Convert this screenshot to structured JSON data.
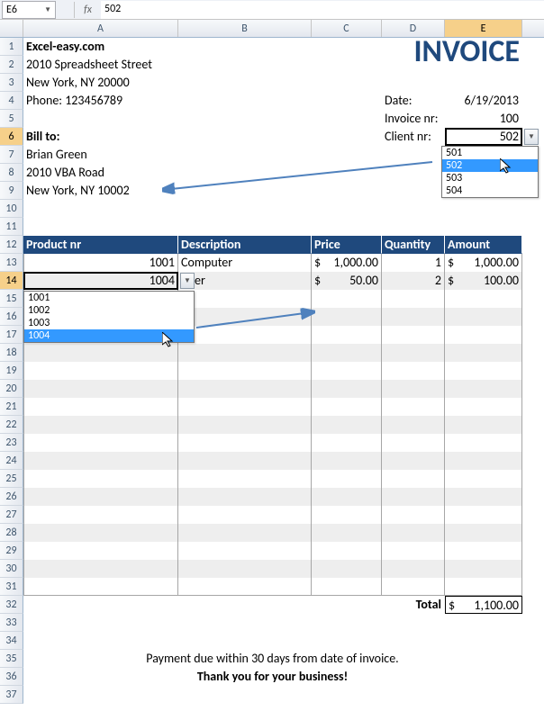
{
  "namebox": "E6",
  "fx": "fx",
  "formula_value": "502",
  "columns": [
    "A",
    "B",
    "C",
    "D",
    "E"
  ],
  "rows": [
    "1",
    "2",
    "3",
    "4",
    "5",
    "6",
    "7",
    "8",
    "9",
    "10",
    "11",
    "12",
    "13",
    "14",
    "15",
    "16",
    "17",
    "18",
    "19",
    "20",
    "21",
    "22",
    "23",
    "24",
    "25",
    "26",
    "27",
    "28",
    "29",
    "30",
    "31",
    "32",
    "33",
    "34",
    "35",
    "36",
    "37"
  ],
  "selected_col": "E",
  "selected_row": "6",
  "company": {
    "name": "Excel-easy.com",
    "street": "2010 Spreadsheet Street",
    "city": "New York, NY 20000",
    "phone": "Phone: 123456789"
  },
  "title": "INVOICE",
  "meta": {
    "date_label": "Date:",
    "date_value": "6/19/2013",
    "invoice_label": "Invoice nr:",
    "invoice_value": "100",
    "client_label": "Client nr:",
    "client_value": "502"
  },
  "billto": {
    "label": "Bill to:",
    "name": "Brian Green",
    "street": "2010 VBA Road",
    "city": "New York, NY 10002"
  },
  "table": {
    "headers": {
      "product": "Product nr",
      "desc": "Description",
      "price": "Price",
      "qty": "Quantity",
      "amount": "Amount"
    },
    "rows": [
      {
        "product": "1001",
        "desc": "Computer",
        "price_sym": "$",
        "price": "1,000.00",
        "qty": "1",
        "amt_sym": "$",
        "amt": "1,000.00"
      },
      {
        "product": "1004",
        "desc": "inter",
        "price_sym": "$",
        "price": "50.00",
        "qty": "2",
        "amt_sym": "$",
        "amt": "100.00"
      }
    ],
    "total_label": "Total",
    "total_sym": "$",
    "total": "1,100.00"
  },
  "client_dd": [
    "501",
    "502",
    "503",
    "504"
  ],
  "client_dd_hover": "502",
  "product_dd": [
    "1001",
    "1002",
    "1003",
    "1004"
  ],
  "product_dd_hover": "1004",
  "footer1": "Payment due within 30 days from date of invoice.",
  "footer2": "Thank you for your business!"
}
